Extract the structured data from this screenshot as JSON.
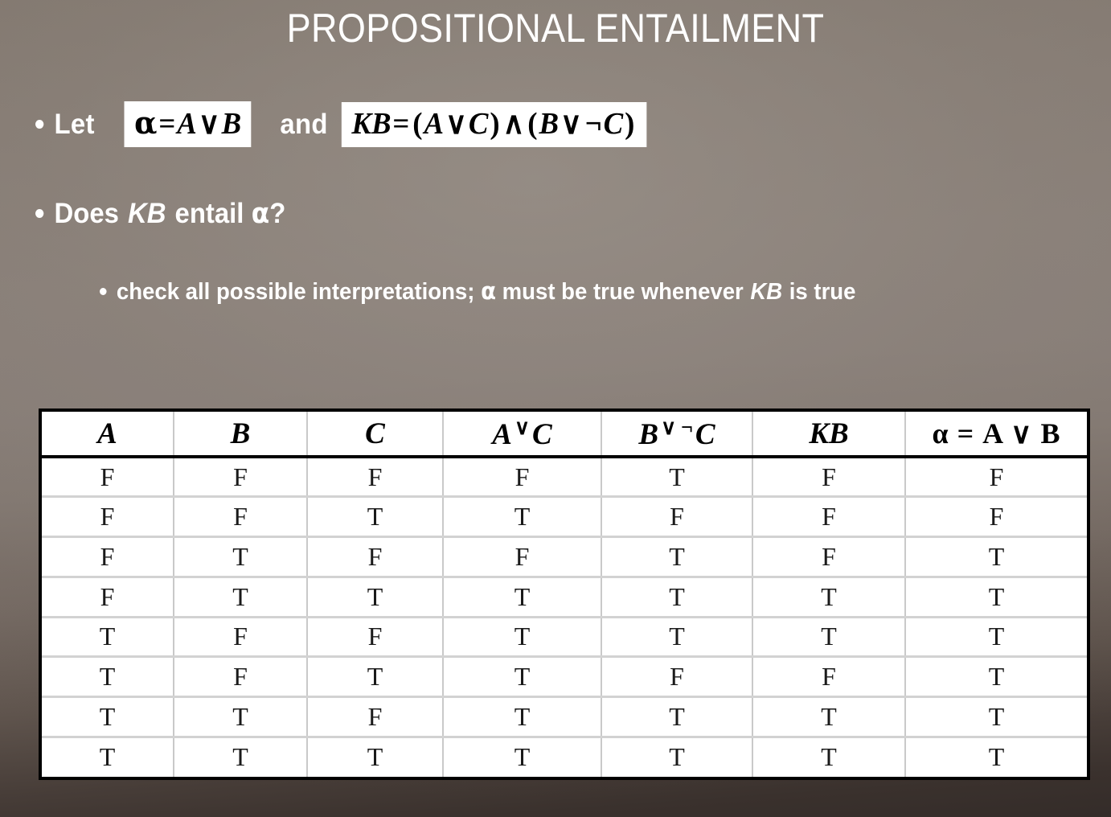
{
  "slide": {
    "title": "PROPOSITIONAL ENTAILMENT",
    "background_top_color": "#877d75",
    "background_bottom_color": "#342c29",
    "text_color": "#ffffff"
  },
  "bullets": {
    "let_label": "Let",
    "and_label": "and",
    "alpha_formula": {
      "greek": "α",
      "equals": "=",
      "left_operand": "A",
      "operator": "∨",
      "right_operand": "B",
      "full_text": "α = A ∨ B"
    },
    "kb_formula": {
      "name": "KB",
      "equals": "=",
      "open1": "(",
      "a": "A",
      "or1": "∨",
      "c1": "C",
      "close1": ")",
      "and_op": "∧",
      "open2": "(",
      "b": "B",
      "or2": "∨",
      "not_op": "¬",
      "c2": "C",
      "close2": ")",
      "full_text": "KB = (A ∨ C) ∧ (B ∨ ¬C)"
    },
    "question": {
      "prefix": "Does ",
      "kb": "KB",
      "middle": " entail ",
      "alpha": "α",
      "suffix": "?",
      "full_text": "Does KB entail α?"
    },
    "sub_point": {
      "part1": "check all possible interpretations; ",
      "alpha": "α",
      "part2": " must be true whenever ",
      "kb": "KB",
      "part3": " is true",
      "full_text": "check all possible interpretations; α must be true whenever KB is true"
    }
  },
  "truth_table": {
    "headers": [
      {
        "id": "A",
        "text": "A",
        "style": "italic"
      },
      {
        "id": "B",
        "text": "B",
        "style": "italic"
      },
      {
        "id": "C",
        "text": "C",
        "style": "italic"
      },
      {
        "id": "AorC",
        "left": "A",
        "op": "∨",
        "right": "C",
        "text": "A ∨ C",
        "style": "italic-sup-op"
      },
      {
        "id": "BorNotC",
        "left": "B",
        "op": "∨",
        "op2": "¬",
        "right": "C",
        "text": "B ∨ ¬ C",
        "style": "italic-sup-op"
      },
      {
        "id": "KB",
        "text": "KB",
        "style": "italic"
      },
      {
        "id": "alpha",
        "text": "α = A ∨ B",
        "style": "upright"
      }
    ],
    "rows": [
      [
        "F",
        "F",
        "F",
        "F",
        "T",
        "F",
        "F"
      ],
      [
        "F",
        "F",
        "T",
        "T",
        "F",
        "F",
        "F"
      ],
      [
        "F",
        "T",
        "F",
        "F",
        "T",
        "F",
        "T"
      ],
      [
        "F",
        "T",
        "T",
        "T",
        "T",
        "T",
        "T"
      ],
      [
        "T",
        "F",
        "F",
        "T",
        "T",
        "T",
        "T"
      ],
      [
        "T",
        "F",
        "T",
        "T",
        "F",
        "F",
        "T"
      ],
      [
        "T",
        "T",
        "F",
        "T",
        "T",
        "T",
        "T"
      ],
      [
        "T",
        "T",
        "T",
        "T",
        "T",
        "T",
        "T"
      ]
    ],
    "border_color": "#000000",
    "grid_color": "#d2d2d2",
    "cell_background": "#ffffff"
  }
}
